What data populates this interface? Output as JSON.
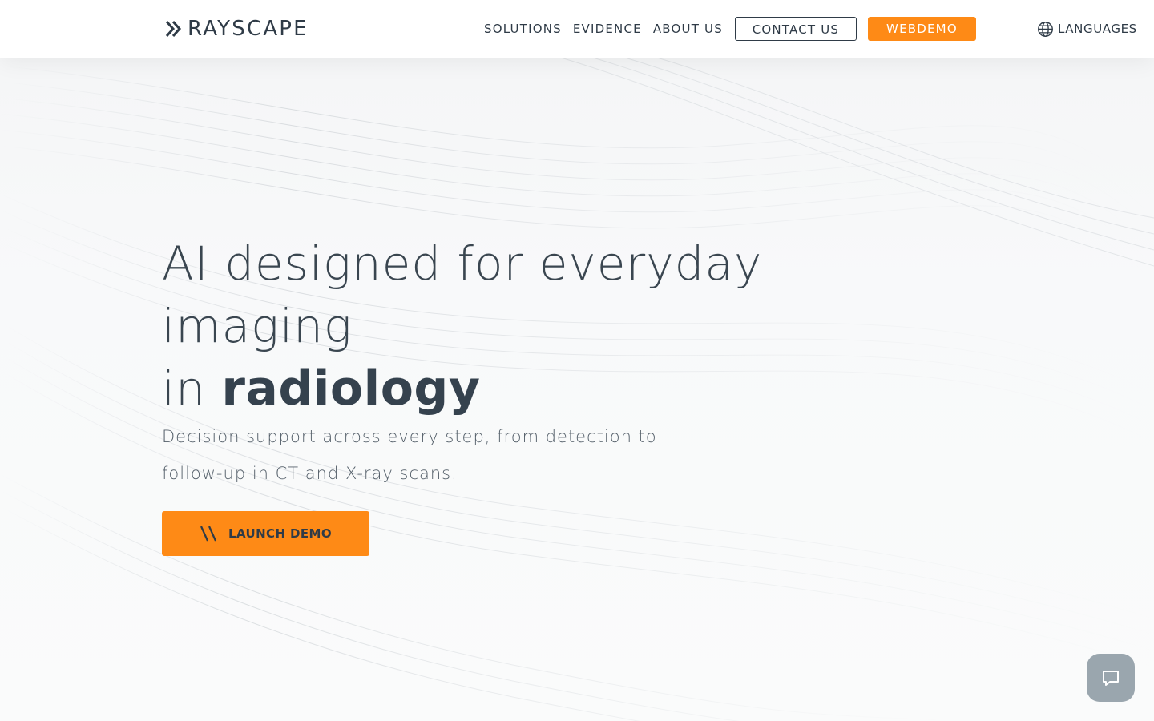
{
  "brand": {
    "logo_text": "RAYSCAPE",
    "accent_color": "#fe8a16",
    "text_color": "#2f3b47"
  },
  "nav": {
    "links": [
      {
        "label": "SOLUTIONS"
      },
      {
        "label": "EVIDENCE"
      },
      {
        "label": "ABOUT US"
      }
    ],
    "contact_label": "CONTACT US",
    "webdemo_label": "WEBDEMO",
    "languages_label": "LANGUAGES",
    "languages_icon": "globe-icon"
  },
  "hero": {
    "title_line1": "AI designed for everyday imaging",
    "title_in": "in",
    "title_accent": "radiology",
    "subtitle_line1": "Decision support across every step, from detection to",
    "subtitle_line2": "follow-up in CT and X-ray scans.",
    "cta_label": "LAUNCH DEMO",
    "cta_icon": "double-slash-icon"
  },
  "chat": {
    "icon": "chat-icon"
  }
}
